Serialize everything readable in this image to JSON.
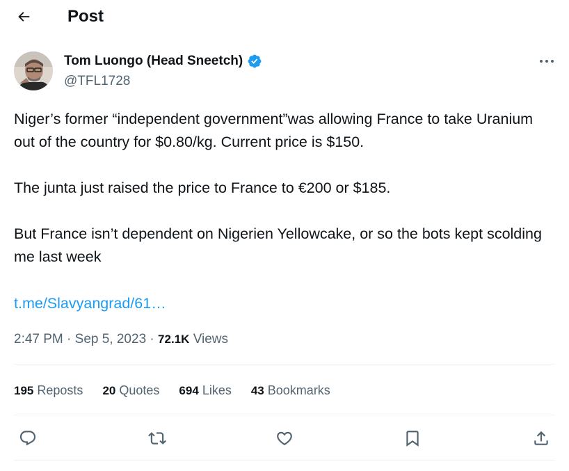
{
  "header": {
    "title": "Post",
    "back_icon": "arrow-left-icon"
  },
  "author": {
    "name": "Tom Luongo (Head Sneetch)",
    "handle": "@TFL1728",
    "verified_icon": "verified-badge-icon",
    "verified_color": "#1d9bf0"
  },
  "post": {
    "paragraphs": [
      "Niger’s former “independent government”was allowing France to take Uranium out of the country for $0.80/kg.  Current price is $150.",
      "The junta just raised the price to France to €200 or $185.",
      "But France isn’t dependent on Nigerien Yellowcake, or so the bots kept scolding me last week"
    ],
    "link": "t.me/Slavyangrad/61…",
    "link_color": "#1d9bf0"
  },
  "meta": {
    "time": "2:47 PM",
    "sep1": "·",
    "date": "Sep 5, 2023",
    "sep2": "·",
    "views_count": "72.1K",
    "views_label": "Views"
  },
  "stats": {
    "reposts_count": "195",
    "reposts_label": "Reposts",
    "quotes_count": "20",
    "quotes_label": "Quotes",
    "likes_count": "694",
    "likes_label": "Likes",
    "bookmarks_count": "43",
    "bookmarks_label": "Bookmarks"
  },
  "actions": {
    "reply": "reply-icon",
    "repost": "repost-icon",
    "like": "heart-icon",
    "bookmark": "bookmark-icon",
    "share": "share-icon"
  },
  "colors": {
    "text": "#0f1419",
    "secondary": "#536471",
    "divider": "#eff3f4"
  }
}
